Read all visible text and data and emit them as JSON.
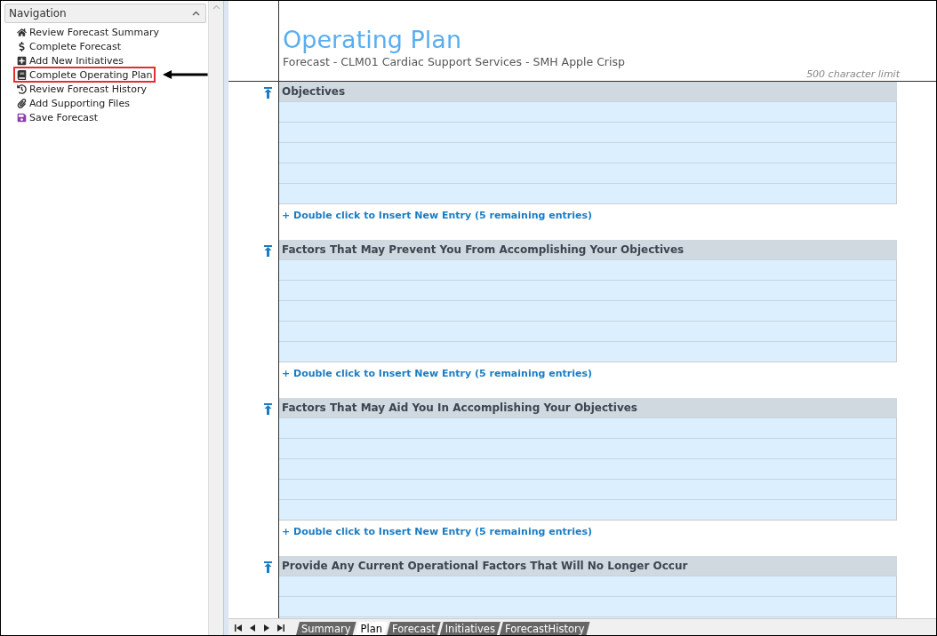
{
  "navigation": {
    "title": "Navigation",
    "items": [
      {
        "label": "Review Forecast Summary",
        "kind": "home",
        "callout": false
      },
      {
        "label": "Complete Forecast",
        "kind": "dollar",
        "callout": false
      },
      {
        "label": "Add New Initiatives",
        "kind": "plus",
        "callout": false
      },
      {
        "label": "Complete Operating Plan",
        "kind": "book",
        "callout": true
      },
      {
        "label": "Review Forecast History",
        "kind": "history",
        "callout": false
      },
      {
        "label": "Add Supporting Files",
        "kind": "clip",
        "callout": false
      },
      {
        "label": "Save Forecast",
        "kind": "save",
        "callout": false
      }
    ]
  },
  "header": {
    "title": "Operating Plan",
    "subtitle": "Forecast - CLM01 Cardiac Support Services - SMH Apple Crisp",
    "limit": "500 character limit"
  },
  "sections": [
    {
      "title": "Objectives",
      "link": "+ Double click to Insert New Entry (5 remaining entries)"
    },
    {
      "title": "Factors That May Prevent You From Accomplishing Your Objectives",
      "link": "+ Double click to Insert New Entry (5 remaining entries)"
    },
    {
      "title": "Factors That May Aid You In Accomplishing Your Objectives",
      "link": "+ Double click to Insert New Entry (5 remaining entries)"
    },
    {
      "title": "Provide Any Current Operational Factors That Will No Longer Occur"
    }
  ],
  "sheet_tabs": [
    {
      "label": "Summary",
      "selected": false
    },
    {
      "label": "Plan",
      "selected": true
    },
    {
      "label": "Forecast",
      "selected": false
    },
    {
      "label": "Initiatives",
      "selected": false
    },
    {
      "label": "ForecastHistory",
      "selected": false
    }
  ]
}
